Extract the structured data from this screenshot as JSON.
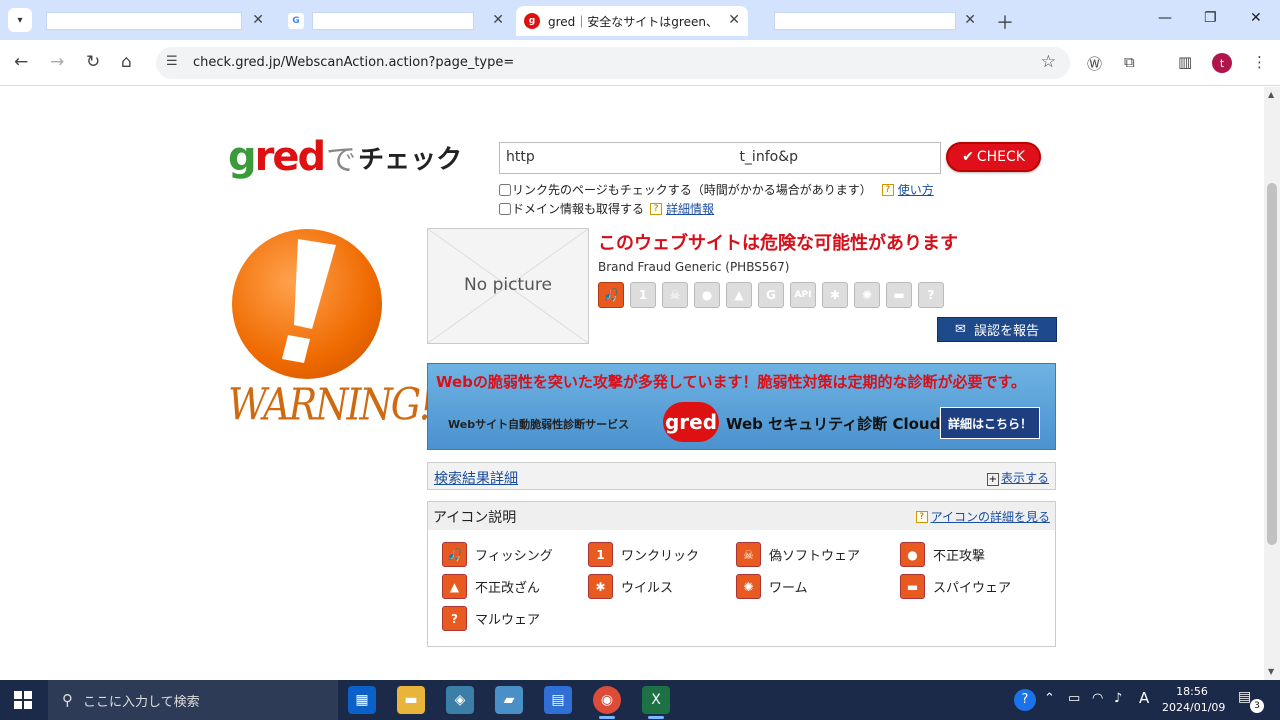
{
  "browser": {
    "tabs": [
      {
        "title": "",
        "favicon": "blank"
      },
      {
        "title": "",
        "favicon": "google-icon"
      },
      {
        "title": "gred｜安全なサイトはgreen、危険",
        "favicon": "gred-icon"
      },
      {
        "title": "",
        "favicon": "blank"
      }
    ],
    "active_tab": 2,
    "url": "check.gred.jp/WebscanAction.action?page_type=",
    "avatar_letter": "t"
  },
  "page": {
    "logo": {
      "gred": "gred",
      "de": "で",
      "check": "チェック"
    },
    "url_input_value": "http                                              t_info&p",
    "check_button": "CHECK",
    "option_links": "リンク先のページもチェックする（時間がかかる場合があります）",
    "option_links_help": "使い方",
    "option_domain": "ドメイン情報も取得する",
    "option_domain_help": "詳細情報",
    "warning_word": "WARNING!",
    "no_picture": "No picture",
    "danger_title": "このウェブサイトは危険な可能性があります",
    "threat_name": "Brand Fraud Generic (PHBS567)",
    "threat_icons": [
      {
        "name": "phishing-icon",
        "glyph": "🎣",
        "on": true
      },
      {
        "name": "one-click-icon",
        "glyph": "1",
        "on": false
      },
      {
        "name": "skull-icon",
        "glyph": "☠",
        "on": false
      },
      {
        "name": "bomb-icon",
        "glyph": "●",
        "on": false
      },
      {
        "name": "fire-icon",
        "glyph": "▲",
        "on": false
      },
      {
        "name": "g-icon",
        "glyph": "G",
        "on": false
      },
      {
        "name": "api-icon",
        "glyph": "API",
        "on": false
      },
      {
        "name": "virus-icon",
        "glyph": "✱",
        "on": false
      },
      {
        "name": "bug-icon",
        "glyph": "✺",
        "on": false
      },
      {
        "name": "gun-icon",
        "glyph": "▬",
        "on": false
      },
      {
        "name": "question-icon",
        "glyph": "?",
        "on": false
      }
    ],
    "report_button": "誤認を報告",
    "banner": {
      "headline": "Webの脆弱性を突いた攻撃が多発しています！脆弱性対策は定期的な診断が必要です。",
      "sub": "Webサイト自動脆弱性診断サービス",
      "badge": "gred",
      "cloud": "Web セキュリティ診断 Cloud",
      "detail_button": "詳細はこちら！"
    },
    "result_title": "検索結果詳細",
    "result_toggle": "表示する",
    "legend_title": "アイコン説明",
    "legend_more": "アイコンの詳細を見る",
    "legend_items": [
      {
        "label": "フィッシング",
        "glyph": "🎣"
      },
      {
        "label": "ワンクリック",
        "glyph": "1"
      },
      {
        "label": "偽ソフトウェア",
        "glyph": "☠"
      },
      {
        "label": "不正攻撃",
        "glyph": "●"
      },
      {
        "label": "不正改ざん",
        "glyph": "▲"
      },
      {
        "label": "ウイルス",
        "glyph": "✱"
      },
      {
        "label": "ワーム",
        "glyph": "✺"
      },
      {
        "label": "スパイウェア",
        "glyph": "▬"
      },
      {
        "label": "マルウェア",
        "glyph": "?"
      }
    ]
  },
  "taskbar": {
    "search_placeholder": "ここに入力して検索",
    "time": "18:56",
    "date": "2024/01/09",
    "notification_count": "3",
    "ime": "A"
  }
}
